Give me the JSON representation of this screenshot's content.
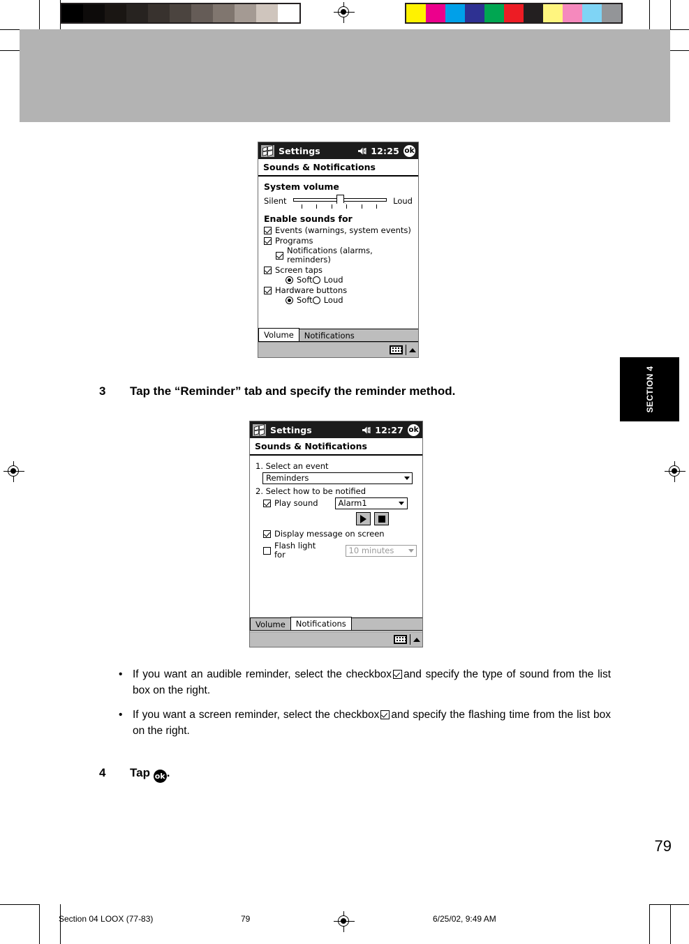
{
  "document": {
    "page_number": "79",
    "section_tab": "SECTION 4"
  },
  "calibration": {
    "gray_swatches": [
      "#000000",
      "#0d0b0a",
      "#1a1613",
      "#272320",
      "#38322e",
      "#4b443f",
      "#655c57",
      "#80766f",
      "#a49a93",
      "#cfc5bd",
      "#ffffff"
    ],
    "color_swatches": [
      "#fff200",
      "#ec008c",
      "#00a0e9",
      "#2e3192",
      "#00a651",
      "#ed1c24",
      "#231f20",
      "#fff57f",
      "#f589bd",
      "#7fd4f5",
      "#939598"
    ]
  },
  "screenshot_volume": {
    "titlebar": {
      "app_title": "Settings",
      "time": "12:25",
      "ok_label": "ok",
      "speaker_icon": "speaker-icon",
      "windows_icon": "windows-flag-icon"
    },
    "subtitle": "Sounds & Notifications",
    "system_volume": {
      "label": "System volume",
      "min_label": "Silent",
      "max_label": "Loud",
      "value_percent": 50,
      "tick_count": 6
    },
    "enable_sounds": {
      "label": "Enable sounds for",
      "items": [
        {
          "label": "Events (warnings, system events)",
          "checked": true,
          "indent": 0
        },
        {
          "label": "Programs",
          "checked": true,
          "indent": 0
        },
        {
          "label": "Notifications (alarms, reminders)",
          "checked": true,
          "indent": 1
        },
        {
          "label": "Screen taps",
          "checked": true,
          "indent": 0
        }
      ],
      "screen_taps_options": {
        "soft": "Soft",
        "loud": "Loud",
        "selected": "Soft"
      },
      "hardware_buttons": {
        "label": "Hardware buttons",
        "checked": true
      },
      "hardware_options": {
        "soft": "Soft",
        "loud": "Loud",
        "selected": "Loud"
      }
    },
    "tabs": [
      {
        "label": "Volume",
        "active": true
      },
      {
        "label": "Notifications",
        "active": false
      }
    ],
    "sip": {
      "keyboard_icon": "keyboard-icon",
      "arrow_icon": "chevron-up-icon"
    }
  },
  "screenshot_notifications": {
    "titlebar": {
      "app_title": "Settings",
      "time": "12:27",
      "ok_label": "ok",
      "speaker_icon": "speaker-icon",
      "windows_icon": "windows-flag-icon"
    },
    "subtitle": "Sounds & Notifications",
    "step1_label": "1. Select an event",
    "event_select_value": "Reminders",
    "step2_label": "2. Select how to be notified",
    "play_sound": {
      "label": "Play sound",
      "checked": true
    },
    "sound_select_value": "Alarm1",
    "transport": {
      "play_icon": "play-icon",
      "stop_icon": "stop-icon"
    },
    "display_message": {
      "label": "Display message on screen",
      "checked": true
    },
    "flash_light": {
      "label": "Flash light for",
      "checked": false
    },
    "flash_select_value": "10 minutes",
    "tabs": [
      {
        "label": "Volume",
        "active": false
      },
      {
        "label": "Notifications",
        "active": true
      }
    ],
    "sip": {
      "keyboard_icon": "keyboard-icon",
      "arrow_icon": "chevron-up-icon"
    }
  },
  "steps": {
    "step3_num": "3",
    "step3_text": "Tap the “Reminder” tab and specify the reminder method.",
    "step4_num": "4",
    "step4_prefix": "Tap ",
    "step4_ok": "ok",
    "step4_suffix": "."
  },
  "bullets": [
    {
      "before": "If you want an audible reminder, select the checkbox",
      "after": "and specify the type of sound from the list box on the right."
    },
    {
      "before": "If you want a screen reminder, select the checkbox",
      "after": "and specify the flashing time from the list box on the right."
    }
  ],
  "footer": {
    "left": "Section 04 LOOX (77-83)",
    "page": "79",
    "date": "6/25/02, 9:49 AM"
  }
}
